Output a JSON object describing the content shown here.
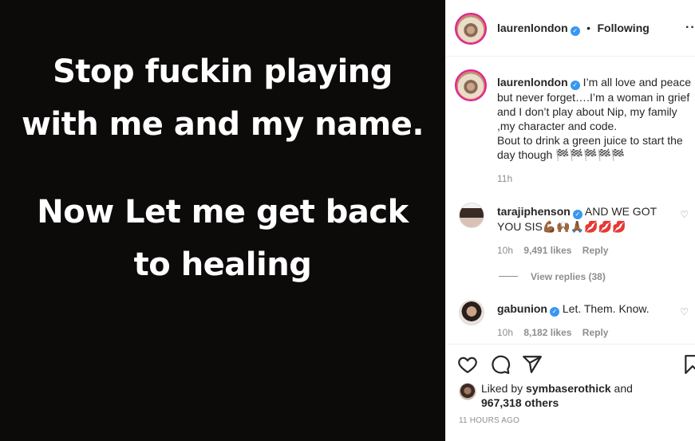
{
  "media": {
    "lines": [
      "Stop fuckin playing",
      "with me and my name.",
      "",
      "Now Let me get back",
      "to healing"
    ]
  },
  "header": {
    "username": "laurenlondon",
    "separator": "•",
    "follow_status": "Following",
    "more_icon": "more-horizontal-icon"
  },
  "caption": {
    "username": "laurenlondon",
    "text": "I’m all love and peace but never forget….I’m a woman in grief and I don’t play about Nip, my family ,my character and code.",
    "text2": "Bout to drink a green juice to start the day though 🏁🏁🏁🏁🏁",
    "time": "11h"
  },
  "comments": [
    {
      "username": "tarajiphenson",
      "text": "AND WE GOT YOU SIS💪🏾🙌🏾🙏🏾💋💋💋",
      "time": "10h",
      "likes": "9,491 likes",
      "reply": "Reply",
      "view_replies": "View replies (38)"
    },
    {
      "username": "gabunion",
      "text": "Let. Them. Know.",
      "time": "10h",
      "likes": "8,182 likes",
      "reply": "Reply"
    }
  ],
  "footer": {
    "liked_by_prefix": "Liked by",
    "liked_by_user": "symbaserothick",
    "liked_by_and": "and",
    "liked_by_others": "967,318 others",
    "timestamp": "11 HOURS AGO"
  },
  "colors": {
    "media_bg": "#0d0a0a",
    "verified": "#3897f0",
    "secondary_text": "#8e8e8e"
  }
}
